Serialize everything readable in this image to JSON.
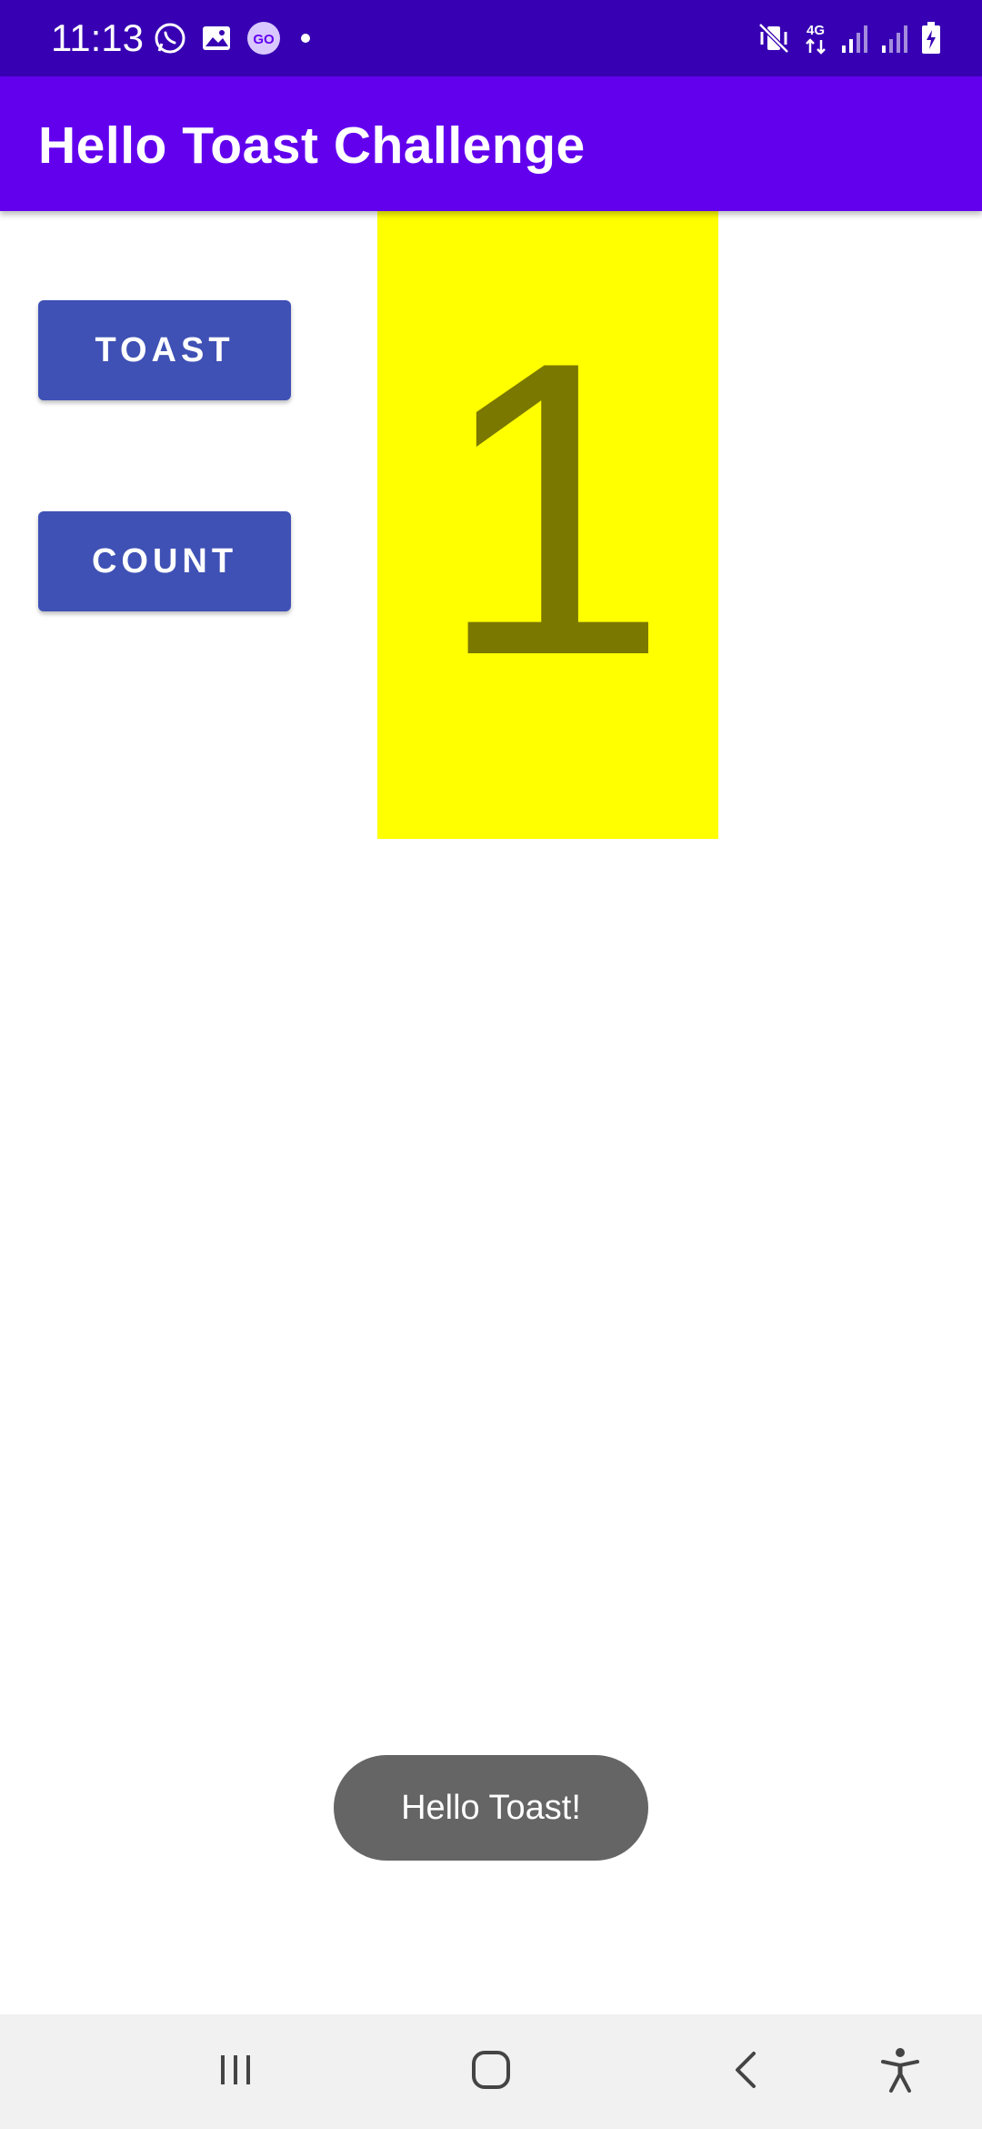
{
  "status_bar": {
    "time": "11:13",
    "left_icons": [
      "whatsapp-icon",
      "gallery-icon",
      "go-icon",
      "notification-dot-icon"
    ],
    "right_icons": [
      "mute-vibrate-icon",
      "4g-data-icon",
      "signal-icon",
      "signal-icon",
      "battery-charging-icon"
    ],
    "network_label": "4G"
  },
  "app_bar": {
    "title": "Hello Toast Challenge"
  },
  "buttons": {
    "toast_label": "TOAST",
    "count_label": "COUNT"
  },
  "counter": {
    "value": "1"
  },
  "toast": {
    "message": "Hello Toast!"
  },
  "nav_bar": {
    "icons": [
      "recents-icon",
      "home-icon",
      "back-icon",
      "accessibility-icon"
    ]
  },
  "colors": {
    "status_bar": "#3700b3",
    "app_bar": "#6200ee",
    "button": "#3f51b5",
    "counter_background": "#ffff00",
    "counter_text": "#7b7800",
    "toast_background": "#656565",
    "nav_bar": "#f1f1f1"
  }
}
